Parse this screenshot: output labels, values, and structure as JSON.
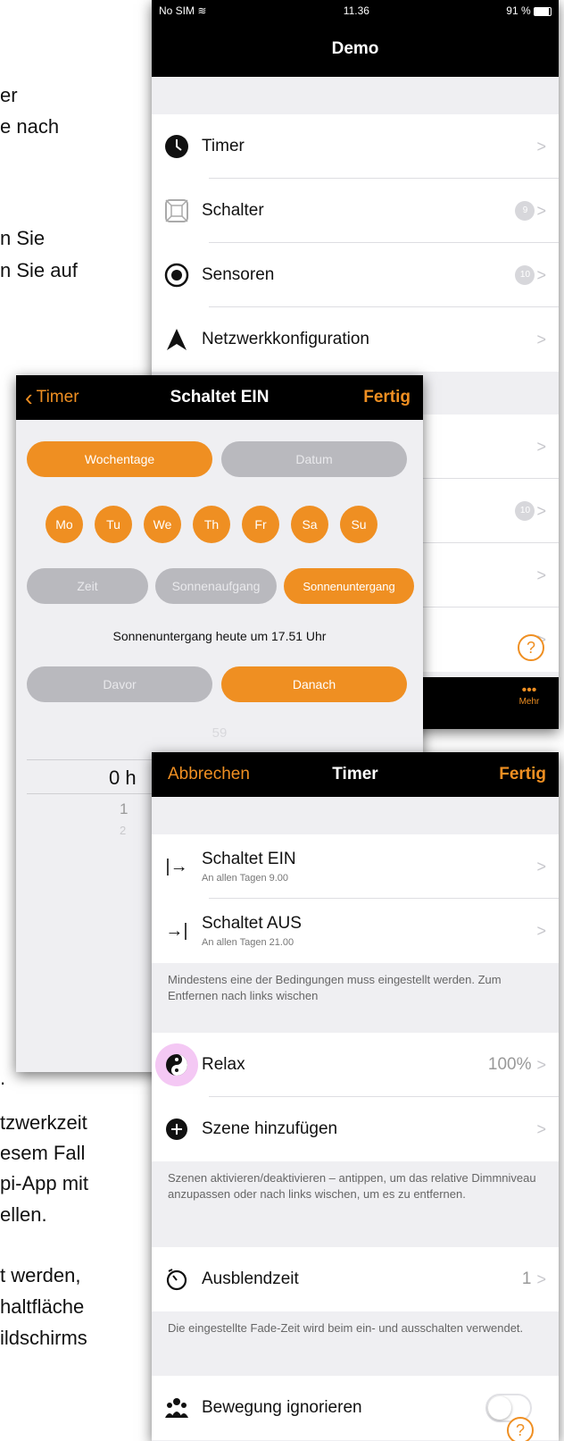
{
  "doc_fragments": {
    "l1": "er",
    "l2": "e nach",
    "l3": "n Sie",
    "l4": "n Sie auf",
    "l5": ".",
    "l6": "tzwerkzeit",
    "l7": "esem Fall",
    "l8": "pi-App   mit",
    "l9": "ellen.",
    "l10": "t   werden,",
    "l11": "haltfläche",
    "l12": "ildschirms"
  },
  "screen1": {
    "status": {
      "carrier": "No SIM",
      "time": "11.36",
      "battery": "91 %"
    },
    "title": "Demo",
    "items": [
      {
        "label": "Timer",
        "icon": "clock-icon"
      },
      {
        "label": "Schalter",
        "icon": "switch-icon",
        "badge": "9"
      },
      {
        "label": "Sensoren",
        "icon": "sensor-icon",
        "badge": "10"
      },
      {
        "label": "Netzwerkkonfiguration",
        "icon": "network-icon"
      }
    ],
    "hidden_badge": "10",
    "tab_more": "Mehr",
    "tab_more_icon": "•••",
    "help": "?"
  },
  "screen2": {
    "back": "Timer",
    "title": "Schaltet EIN",
    "done": "Fertig",
    "mode": {
      "weekdays": "Wochentage",
      "date": "Datum"
    },
    "days": [
      "Mo",
      "Tu",
      "We",
      "Th",
      "Fr",
      "Sa",
      "Su"
    ],
    "time_mode": {
      "time": "Zeit",
      "sunrise": "Sonnenaufgang",
      "sunset": "Sonnenuntergang"
    },
    "sunset_text": "Sonnenuntergang heute um 17.51 Uhr",
    "offset": {
      "before": "Davor",
      "after": "Danach"
    },
    "picker": {
      "above": "59",
      "current": "0 h",
      "n1": "1",
      "n2": "2"
    }
  },
  "screen3": {
    "cancel": "Abbrechen",
    "title": "Timer",
    "done": "Fertig",
    "on": {
      "label": "Schaltet EIN",
      "sub": "An allen Tagen  9.00",
      "icon": "|→"
    },
    "off": {
      "label": "Schaltet AUS",
      "sub": "An allen Tagen  21.00",
      "icon": "→|"
    },
    "note1": "Mindestens eine der Bedingungen muss eingestellt werden. Zum Entfernen nach links wischen",
    "scene": {
      "label": "Relax",
      "value": "100%"
    },
    "add_scene": "Szene hinzufügen",
    "note2": "Szenen aktivieren/deaktivieren – antippen, um das relative Dimmniveau anzupassen oder nach links wischen, um es zu entfernen.",
    "fade": {
      "label": "Ausblendzeit",
      "value": "1"
    },
    "note3": "Die eingestellte Fade-Zeit wird beim ein- und ausschalten verwendet.",
    "motion": "Bewegung ignorieren",
    "help": "?"
  },
  "colors": {
    "accent": "#ef8f22",
    "inactive": "#b9b9be",
    "bar": "#000000"
  }
}
